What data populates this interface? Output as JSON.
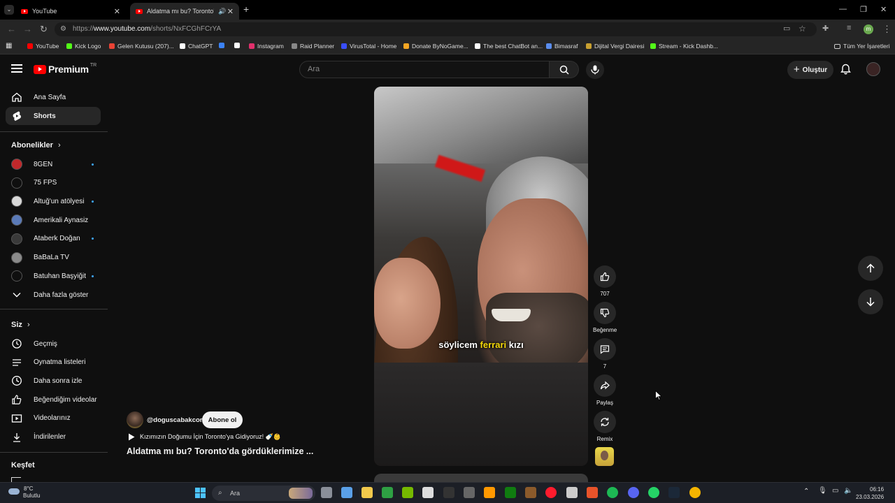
{
  "browser": {
    "tabs": [
      {
        "title": "YouTube"
      },
      {
        "title": "Aldatma mı bu? Toronto'da"
      }
    ],
    "url_prefix": "https://",
    "url_domain": "www.youtube.com",
    "url_path": "/shorts/NxFCGhFCrYA",
    "bookmarks": [
      {
        "label": "YouTube",
        "color": "#ff0000"
      },
      {
        "label": "Kick Logo",
        "color": "#53fc18"
      },
      {
        "label": "Gelen Kutusu (207)...",
        "color": "#ea4335"
      },
      {
        "label": "ChatGPT",
        "color": "#ffffff"
      },
      {
        "label": "",
        "color": "#3b82f6"
      },
      {
        "label": "",
        "color": "#ffffff"
      },
      {
        "label": "Instagram",
        "color": "#e1306c"
      },
      {
        "label": "Raid Planner",
        "color": "#888888"
      },
      {
        "label": "VirusTotal - Home",
        "color": "#394eff"
      },
      {
        "label": "Donate ByNoGame...",
        "color": "#f5a623"
      },
      {
        "label": "The best ChatBot an...",
        "color": "#ffffff"
      },
      {
        "label": "Bimasraf",
        "color": "#5a8dee"
      },
      {
        "label": "Dijital Vergi Dairesi",
        "color": "#c8a030"
      },
      {
        "label": "Stream - Kick Dashb...",
        "color": "#53fc18"
      }
    ],
    "all_bookmarks": "Tüm Yer İşaretleri"
  },
  "header": {
    "logo_text": "Premium",
    "logo_region": "TR",
    "search_placeholder": "Ara",
    "create_label": "Oluştur"
  },
  "sidebar": {
    "main": [
      {
        "label": "Ana Sayfa"
      },
      {
        "label": "Shorts"
      }
    ],
    "subs_title": "Abonelikler",
    "subscriptions": [
      {
        "label": "8GEN",
        "color": "#c0282b",
        "dot": true
      },
      {
        "label": "75 FPS",
        "color": "#0f0f0f",
        "dot": false
      },
      {
        "label": "Altuğ'un atölyesi",
        "color": "#d8d8d8",
        "dot": true
      },
      {
        "label": "Amerikali Aynasiz",
        "color": "#5a7ab8",
        "dot": false
      },
      {
        "label": "Ataberk Doğan",
        "color": "#3a3a3a",
        "dot": true
      },
      {
        "label": "BaBaLa TV",
        "color": "#8a8a8a",
        "dot": false
      },
      {
        "label": "Batuhan Başyiğit",
        "color": "#0f0f0f",
        "dot": true
      }
    ],
    "show_more": "Daha fazla göster",
    "you_title": "Siz",
    "you_items": [
      {
        "label": "Geçmiş"
      },
      {
        "label": "Oynatma listeleri"
      },
      {
        "label": "Daha sonra izle"
      },
      {
        "label": "Beğendiğim videolar"
      },
      {
        "label": "Videolarınız"
      },
      {
        "label": "İndirilenler"
      }
    ],
    "explore_title": "Keşfet"
  },
  "video": {
    "caption_before": "söylicem",
    "caption_highlight": "ferrari",
    "caption_after": "kızı",
    "channel": "@doguscabakcor",
    "subscribe_label": "Abone ol",
    "music_line": "Kızımızın Doğumu İçin Toronto'ya Gidiyoruz! 🍼👶",
    "title": "Aldatma mı bu? Toronto'da gördüklerimize ..."
  },
  "actions": {
    "likes": "707",
    "dislike_label": "Beğenme",
    "comments": "7",
    "share_label": "Paylaş",
    "remix_label": "Remix"
  },
  "taskbar": {
    "temp": "8°C",
    "weather": "Bulutlu",
    "search": "Ara",
    "time": "06:16",
    "date": "23.03.2026"
  }
}
